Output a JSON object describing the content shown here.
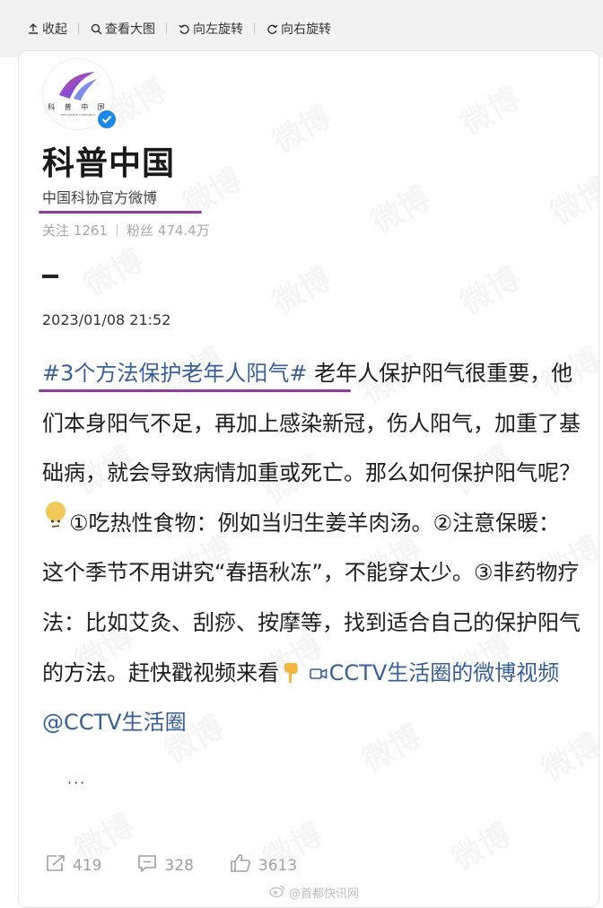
{
  "toolbar": {
    "collapse": "收起",
    "view_large": "查看大图",
    "rotate_left": "向左旋转",
    "rotate_right": "向右旋转"
  },
  "profile": {
    "logo_text": "科 普 中 国",
    "logo_subtext": "THE SCIENCE COMMUNITY",
    "name": "科普中国",
    "description": "中国科协官方微博",
    "following_label": "关注",
    "following_count": "1261",
    "followers_label": "粉丝",
    "followers_count": "474.4万"
  },
  "post": {
    "date": "2023/01/08 21:52",
    "hashtag": "#3个方法保护老年人阳气#",
    "text_1": "老年人保护阳气很重要，他们本身阳气不足，再加上感染新冠，伤人阳气，加重了基础病，就会导致病情加重或死亡。那么如何保护阳气呢？",
    "text_2": "①吃热性食物：例如当归生姜羊肉汤。②注意保暖：这个季节不用讲究“春捂秋冻”，不能穿太少。③非药物疗法：比如艾灸、刮痧、按摩等，找到适合自己的保护阳气的方法。赶快戳视频来看",
    "video_link": "CCTV生活圈的微博视频",
    "mention": "@CCTV生活圈",
    "ellipsis": "···"
  },
  "actions": {
    "repost_count": "419",
    "comment_count": "328",
    "like_count": "3613"
  },
  "watermark": {
    "text": "微博",
    "bottom_text": "@首都快讯网"
  },
  "colors": {
    "link": "#3a5f94",
    "annotation_underline": "#8e3d9c",
    "verified": "#1e88e5"
  }
}
